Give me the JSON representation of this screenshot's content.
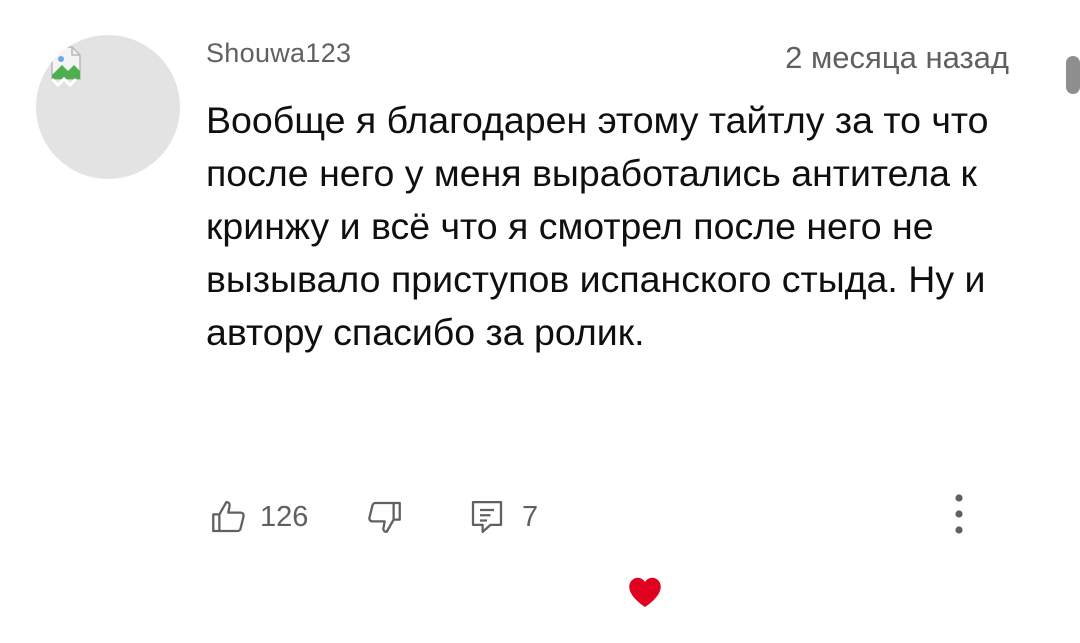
{
  "comment": {
    "author": "Shouwa123",
    "time": "2 месяца назад",
    "text": "Вообще я благодарен этому тайтлу за то что после него у меня выработались антитела к кринжу и всё что я смотрел после него не вызывало приступов испанского стыда. Ну и автору спасибо за ролик."
  },
  "actions": {
    "likes": "126",
    "replies": "7"
  },
  "icons": {
    "avatar": "broken-image-icon",
    "like": "thumbs-up-icon",
    "dislike": "thumbs-down-icon",
    "reply": "reply-icon",
    "more": "more-vertical-icon",
    "heart": "heart-icon"
  },
  "colors": {
    "text": "#0f0f0f",
    "secondary": "#606060",
    "heart": "#e0001f",
    "avatar_bg": "#e3e3e3"
  }
}
